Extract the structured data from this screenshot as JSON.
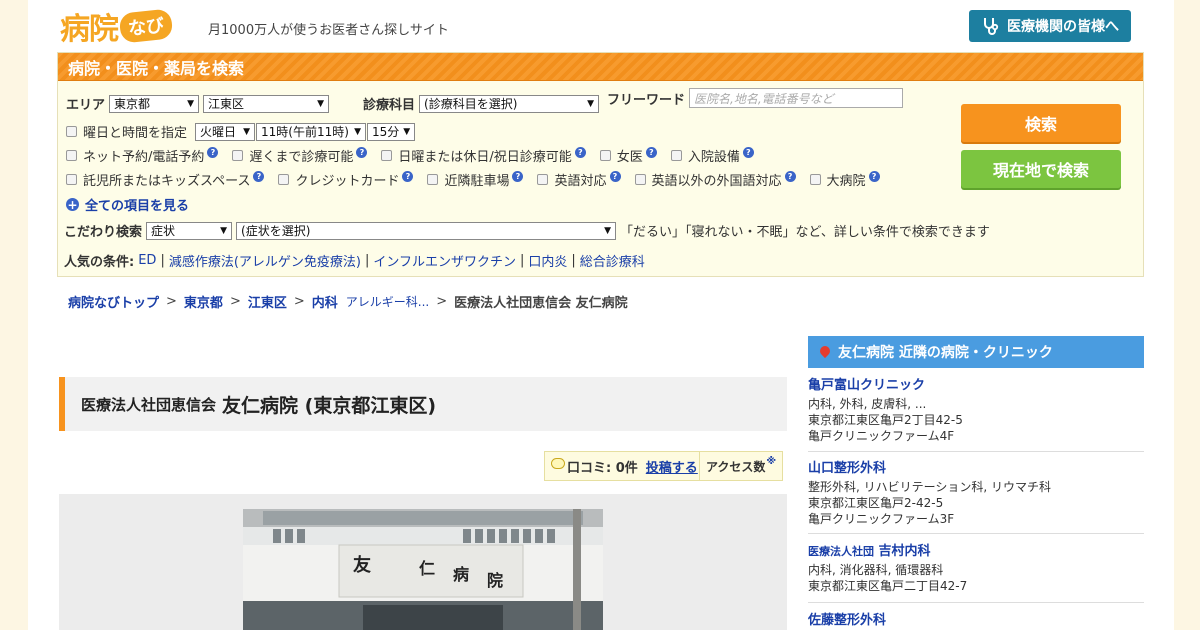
{
  "header": {
    "logo_main": "病院",
    "logo_badge": "なび",
    "tagline": "月1000万人が使うお医者さん探しサイト",
    "pro_button": "医療機関の皆様へ"
  },
  "search": {
    "title": "病院・医院・薬局を検索",
    "area_label": "エリア",
    "pref_value": "東京都",
    "city_value": "江東区",
    "dept_label": "診療科目",
    "dept_value": "(診療科目を選択)",
    "freeword_label": "フリーワード",
    "freeword_placeholder": "医院名,地名,電話番号など",
    "time_label": "曜日と時間を指定",
    "day_value": "火曜日",
    "hour_value": "11時(午前11時)",
    "minute_value": "15分",
    "options_row1": [
      "ネット予約/電話予約",
      "遅くまで診療可能",
      "日曜または休日/祝日診療可能",
      "女医",
      "入院設備"
    ],
    "options_row2": [
      "託児所またはキッズスペース",
      "クレジットカード",
      "近隣駐車場",
      "英語対応",
      "英語以外の外国語対応",
      "大病院"
    ],
    "show_all": "全ての項目を見る",
    "kodawari_label": "こだわり検索",
    "kodawari_type": "症状",
    "kodawari_value": "(症状を選択)",
    "kodawari_hint": "「だるい」「寝れない・不眠」など、詳しい条件で検索できます",
    "popular_label": "人気の条件:",
    "popular": [
      "ED",
      "減感作療法(アレルゲン免疫療法)",
      "インフルエンザワクチン",
      "口内炎",
      "総合診療科"
    ],
    "search_button": "検索",
    "geo_button": "現在地で検索"
  },
  "breadcrumb": {
    "items": [
      "病院なびトップ",
      "東京都",
      "江東区",
      "内科"
    ],
    "extra": "アレルギー科...",
    "current": "医療法人社団恵信会 友仁病院"
  },
  "hospital": {
    "corp": "医療法人社団恵信会",
    "name": "友仁病院 (東京都江東区)",
    "review_label": "口コミ: 0件",
    "post_link": "投稿する",
    "access_label": "アクセス数",
    "access_mark": "※",
    "sign_text": [
      "友",
      "仁",
      "病",
      "院"
    ]
  },
  "sidebar": {
    "title": "友仁病院 近隣の病院・クリニック",
    "clinics": [
      {
        "prefix": "",
        "name": "亀戸富山クリニック",
        "depts": "内科, 外科, 皮膚科, ...",
        "addr1": "東京都江東区亀戸2丁目42-5",
        "addr2": "亀戸クリニックファーム4F"
      },
      {
        "prefix": "",
        "name": "山口整形外科",
        "depts": "整形外科, リハビリテーション科, リウマチ科",
        "addr1": "東京都江東区亀戸2-42-5",
        "addr2": "亀戸クリニックファーム3F"
      },
      {
        "prefix": "医療法人社団",
        "name": "吉村内科",
        "depts": "内科, 消化器科, 循環器科",
        "addr1": "東京都江東区亀戸二丁目42-7",
        "addr2": ""
      },
      {
        "prefix": "",
        "name": "佐藤整形外科",
        "depts": "",
        "addr1": "",
        "addr2": ""
      }
    ]
  },
  "colors": {
    "accent_orange": "#f7931e",
    "accent_green": "#7cc540",
    "sidebar_blue": "#4a9ce0",
    "link_blue": "#1a3fa8"
  }
}
